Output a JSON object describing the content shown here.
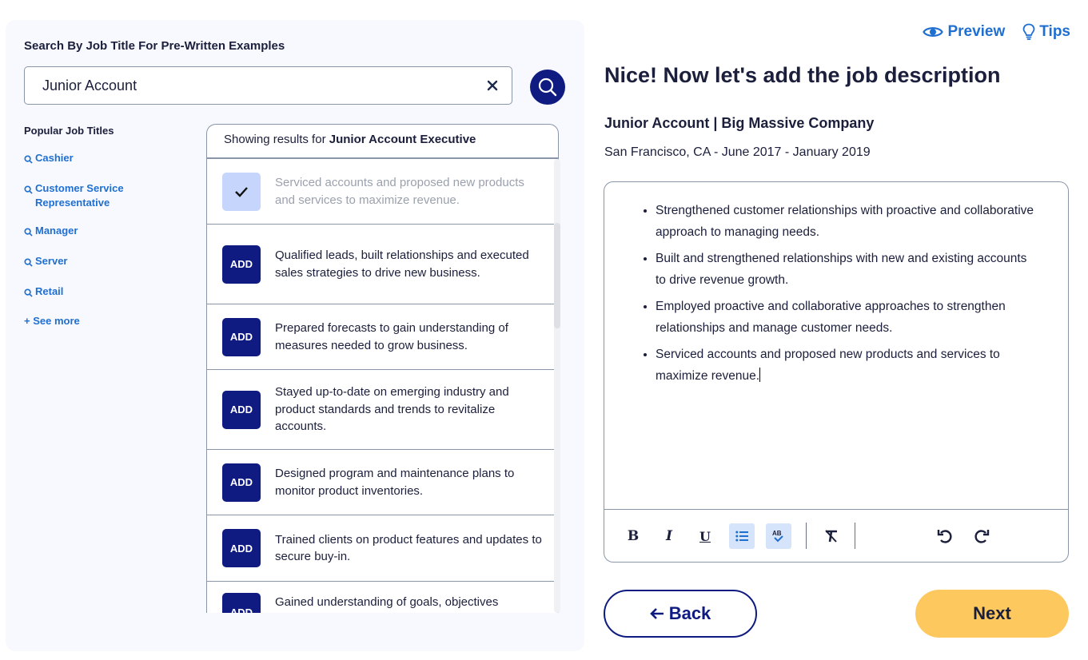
{
  "search": {
    "heading": "Search By Job Title For Pre-Written Examples",
    "value": "Junior Account",
    "clear_icon": "close-icon",
    "search_icon": "search-icon"
  },
  "popular": {
    "heading": "Popular Job Titles",
    "items": [
      {
        "label": "Cashier"
      },
      {
        "label": "Customer Service Representative"
      },
      {
        "label": "Manager"
      },
      {
        "label": "Server"
      },
      {
        "label": "Retail"
      }
    ],
    "see_more": "+ See more"
  },
  "results": {
    "prefix": "Showing results for ",
    "query": "Junior Account Executive",
    "add_label": "ADD",
    "items": [
      {
        "text": "Serviced accounts and proposed new products and services to maximize revenue.",
        "added": true
      },
      {
        "text": "Qualified leads, built relationships and executed sales strategies to drive new business.",
        "added": false
      },
      {
        "text": "Prepared forecasts to gain understanding of measures needed to grow business.",
        "added": false
      },
      {
        "text": "Stayed up-to-date on emerging industry and product standards and trends to revitalize accounts.",
        "added": false
      },
      {
        "text": "Designed program and maintenance plans to monitor product inventories.",
        "added": false
      },
      {
        "text": "Trained clients on product features and updates to secure buy-in.",
        "added": false
      },
      {
        "text": "Gained understanding of goals, objectives",
        "added": false
      }
    ]
  },
  "header_links": {
    "preview": "Preview",
    "tips": "Tips"
  },
  "main": {
    "title": "Nice! Now let's add the job description",
    "job_title": "Junior Account | Big Massive Company",
    "job_meta": "San Francisco, CA - June 2017 - January 2019",
    "bullets": [
      "Strengthened customer relationships with proactive and collaborative approach to managing needs.",
      "Built and strengthened relationships with new and existing accounts to drive revenue growth.",
      "Employed proactive and collaborative approaches to strengthen relationships and manage customer needs.",
      "Serviced accounts and proposed new products and services to maximize revenue."
    ]
  },
  "toolbar": {
    "bold": "B",
    "italic": "I",
    "underline": "U",
    "bullet_list_active": true,
    "spellcheck_active": true
  },
  "nav": {
    "back": "Back",
    "next": "Next"
  },
  "colors": {
    "brand_navy": "#0f1b80",
    "link_blue": "#1f6fd1",
    "next_yellow": "#fdc95f",
    "panel_bg": "#f7f9fe"
  }
}
